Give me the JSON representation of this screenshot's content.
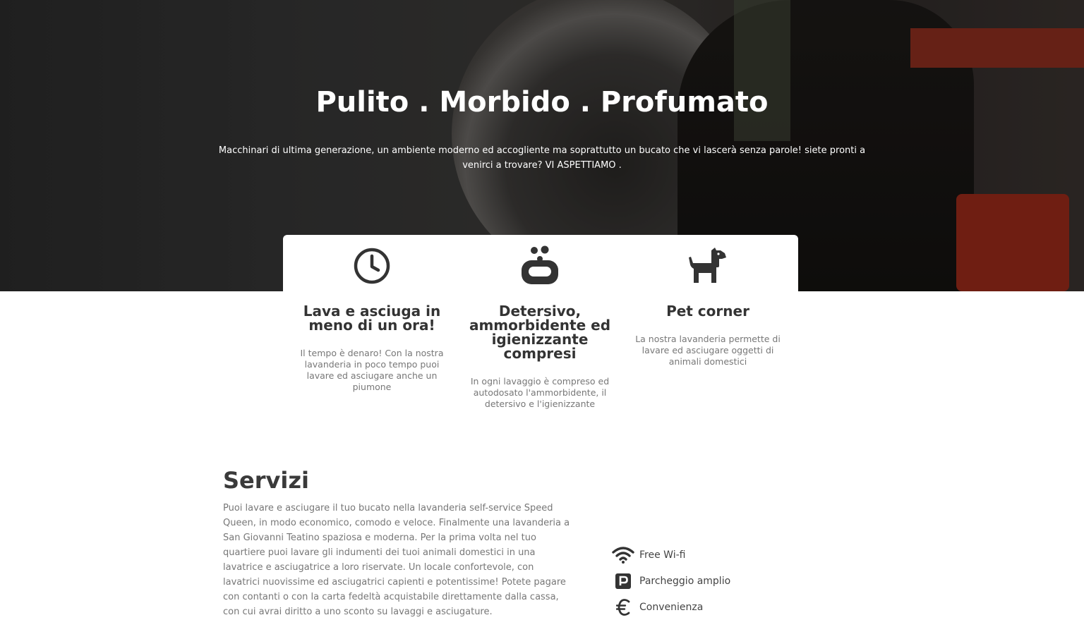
{
  "hero": {
    "title": "Pulito . Morbido . Profumato",
    "subtitle": "Macchinari di ultima generazione, un ambiente moderno ed accogliente ma soprattutto un bucato che vi lascerà senza parole! siete pronti a venirci a trovare? VI ASPETTIAMO ."
  },
  "features": [
    {
      "icon": "clock-icon",
      "title": "Lava e asciuga in meno di un ora!",
      "text": "Il tempo è denaro! Con la nostra lavanderia in poco tempo puoi lavare ed asciugare anche un piumone"
    },
    {
      "icon": "soap-icon",
      "title": "Detersivo, ammorbidente ed igienizzante compresi",
      "text": "In ogni lavaggio è compreso ed autodosato l'ammorbidente, il detersivo e l'igienizzante"
    },
    {
      "icon": "dog-icon",
      "title": "Pet corner",
      "text": "La nostra lavanderia permette di lavare ed asciugare oggetti di animali domestici"
    }
  ],
  "servizi": {
    "title": "Servizi",
    "text": "Puoi lavare e asciugare il tuo bucato nella lavanderia self-service Speed Queen, in modo economico, comodo e veloce. Finalmente una lavanderia a San Giovanni Teatino spaziosa e moderna. Per la prima volta nel tuo quartiere puoi lavare gli indumenti dei tuoi animali domestici in una lavatrice e asciugatrice a loro riservate. Un locale confortevole, con lavatrici nuovissime ed asciugatrici capienti e potentissime! Potete pagare con contanti o con la carta fedeltà acquistabile direttamente dalla cassa, con cui avrai diritto a uno sconto su lavaggi e asciugature.",
    "items": [
      {
        "icon": "wifi-icon",
        "label": "Free Wi-fi"
      },
      {
        "icon": "parking-icon",
        "label": "Parcheggio amplio"
      },
      {
        "icon": "euro-icon",
        "label": "Convenienza"
      }
    ]
  },
  "colors": {
    "icon": "#333333",
    "heading": "#3a3a3a",
    "body_text": "#777777",
    "accent_red": "#c8341e"
  }
}
